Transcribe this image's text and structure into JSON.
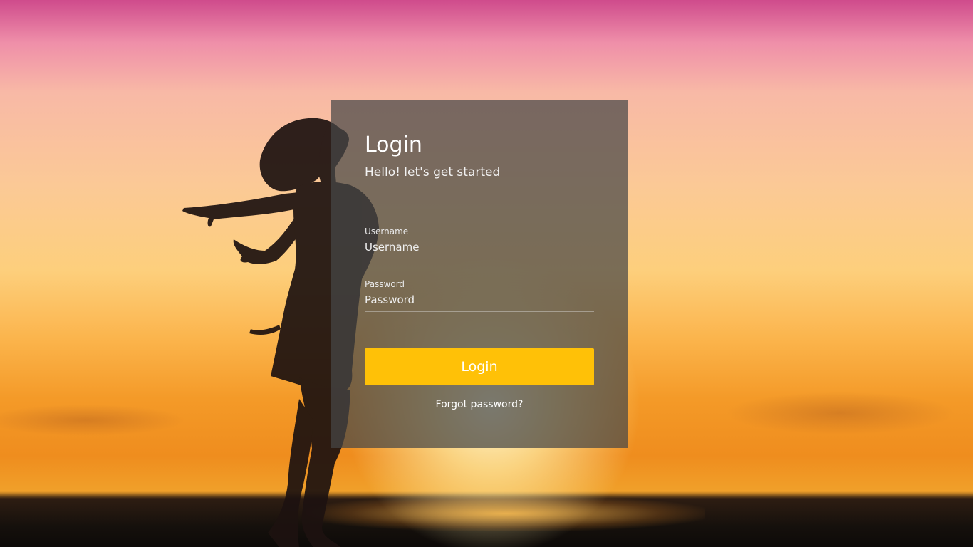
{
  "login": {
    "title": "Login",
    "subtitle": "Hello! let's get started",
    "username": {
      "label": "Username",
      "placeholder": "Username"
    },
    "password": {
      "label": "Password",
      "placeholder": "Password"
    },
    "submit_label": "Login",
    "forgot_label": "Forgot password?"
  },
  "colors": {
    "accent": "#ffc107",
    "panel": "#464646",
    "text": "#ffffff"
  }
}
